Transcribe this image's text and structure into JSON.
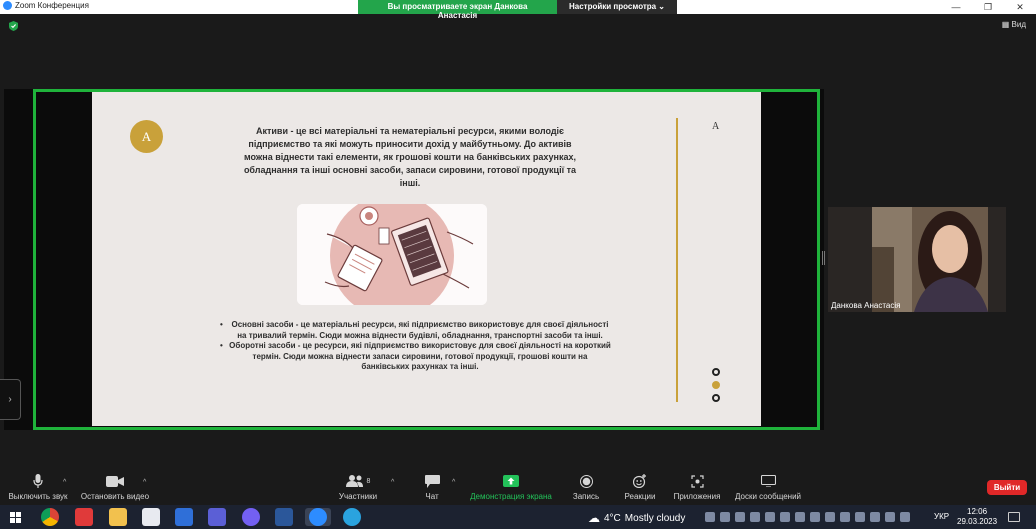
{
  "titlebar": {
    "app_title": "Zoom Конференция",
    "share_banner_text": "Вы просматриваете экран Данкова Анастасія",
    "view_options_label": "Настройки просмотра",
    "controls": [
      "—",
      "❐",
      "✕"
    ]
  },
  "view_button": {
    "label": "Вид"
  },
  "slide": {
    "logo_letter": "A",
    "corner_letter": "A",
    "title_text": "Активи - це всі матеріальні та нематеріальні ресурси, якими володіє підприємство та які можуть приносити дохід у майбутньому. До активів можна віднести такі елементи, як грошові кошти на банківських рахунках, обладнання та інші основні засоби, запаси сировини, готової продукції та інші.",
    "bullets": [
      "Основні засоби - це матеріальні ресурси, які підприємство використовує для своєї діяльності на тривалий термін. Сюди можна віднести будівлі, обладнання, транспортні засоби та інші.",
      "Оборотні засоби - це ресурси, які підприємство використовує для своєї діяльності на короткий термін. Сюди можна віднести запаси сировини, готової продукції, грошові кошти на банківських рахунках та інші."
    ],
    "accent_color": "#c9a13a"
  },
  "participant": {
    "name": "Данкова Анастасія"
  },
  "toolbar": {
    "mute": "Выключить звук",
    "stop_video": "Остановить видео",
    "participants": "Участники",
    "participants_count": "8",
    "chat": "Чат",
    "share_screen": "Демонстрация экрана",
    "record": "Запись",
    "reactions": "Реакции",
    "apps": "Приложения",
    "whiteboards": "Доски сообщений",
    "leave": "Выйти",
    "caret": "^"
  },
  "taskbar": {
    "weather_temp": "4°C",
    "weather_desc": "Mostly cloudy",
    "language": "УКР",
    "time": "12:06",
    "date": "29.03.2023"
  },
  "colors": {
    "share_green": "#23a54b",
    "frame_green": "#1fb33b",
    "leave_red": "#e02828"
  }
}
